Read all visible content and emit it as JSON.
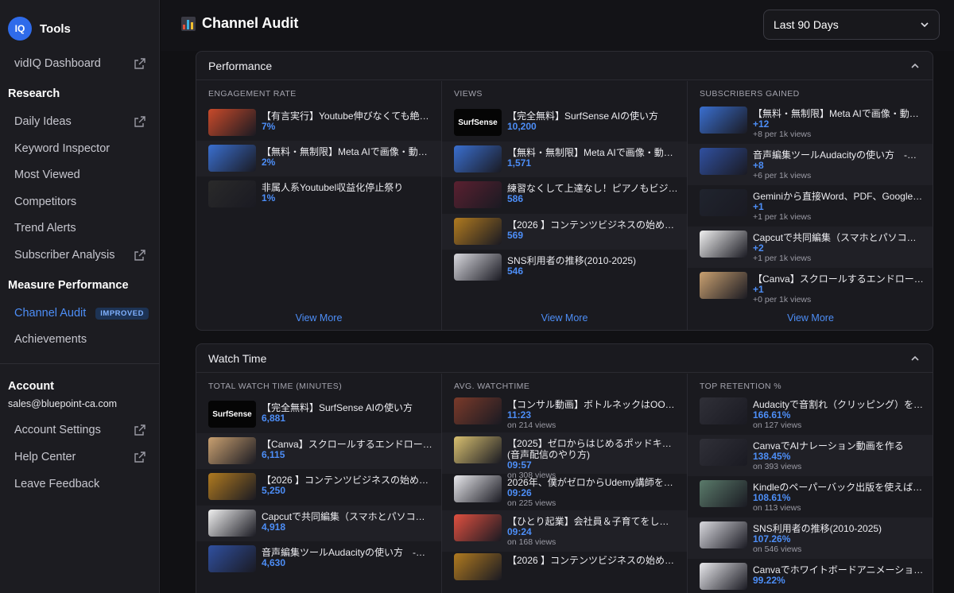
{
  "app": {
    "logo_text": "IQ",
    "name": "Tools"
  },
  "sidebar": {
    "dashboard": "vidIQ Dashboard",
    "research_heading": "Research",
    "research_items": [
      "Daily Ideas",
      "Keyword Inspector",
      "Most Viewed",
      "Competitors",
      "Trend Alerts",
      "Subscriber Analysis"
    ],
    "measure_heading": "Measure Performance",
    "channel_audit": "Channel Audit",
    "channel_audit_badge": "IMPROVED",
    "achievements": "Achievements",
    "account_heading": "Account",
    "email": "sales@bluepoint-ca.com",
    "account_settings": "Account Settings",
    "help_center": "Help Center",
    "leave_feedback": "Leave Feedback"
  },
  "header": {
    "title": "Channel Audit",
    "range": "Last 90 Days"
  },
  "performance": {
    "title": "Performance",
    "engagement": {
      "title": "ENGAGEMENT RATE",
      "items": [
        {
          "title": "【有言実行】Youtube伸びなくても絶対...",
          "value": "7%",
          "thumb": "#c94a2a"
        },
        {
          "title": "【無料・無制限】Meta AIで画像・動画...",
          "value": "2%",
          "thumb": "#3a6fd0"
        },
        {
          "title": "非属人系Youtubel収益化停止祭り",
          "value": "1%",
          "thumb": "#2a2a2a"
        }
      ],
      "view_more": "View More"
    },
    "views": {
      "title": "VIEWS",
      "items": [
        {
          "title": "【完全無料】SurfSense AIの使い方",
          "value": "10,200",
          "thumb": "surfsense",
          "thumb_text": "SurfSense"
        },
        {
          "title": "【無料・無制限】Meta AIで画像・動画...",
          "value": "1,571",
          "thumb": "#3a6fd0"
        },
        {
          "title": "練習なくして上達なし！ピアノもビジネ...",
          "value": "586",
          "thumb": "#5a2030"
        },
        {
          "title": "【2026 】コンテンツビジネスの始め方...",
          "value": "569",
          "thumb": "#b07a20"
        },
        {
          "title": "SNS利用者の推移(2010-2025)",
          "value": "546",
          "thumb": "#d8d8de"
        }
      ],
      "view_more": "View More"
    },
    "subscribers": {
      "title": "SUBSCRIBERS GAINED",
      "items": [
        {
          "title": "【無料・無制限】Meta AIで画像・動画...",
          "value": "+12",
          "sub": "+8 per 1k views",
          "thumb": "#3a6fd0"
        },
        {
          "title": "音声編集ツールAudacityの使い方　-マ...",
          "value": "+8",
          "sub": "+6 per 1k views",
          "thumb": "#3050a0"
        },
        {
          "title": "Geminiから直接Word、PDF、Googleド...",
          "value": "+1",
          "sub": "+1 per 1k views",
          "thumb": "#20242e"
        },
        {
          "title": "Capcutで共同編集（スマホとパソコン同...",
          "value": "+2",
          "sub": "+1 per 1k views",
          "thumb": "#f0f0f0"
        },
        {
          "title": "【Canva】スクロールするエンドロール...",
          "value": "+1",
          "sub": "+0 per 1k views",
          "thumb": "#c9a070"
        }
      ],
      "view_more": "View More"
    }
  },
  "watch": {
    "title": "Watch Time",
    "total": {
      "title": "TOTAL WATCH TIME (MINUTES)",
      "items": [
        {
          "title": "【完全無料】SurfSense AIの使い方",
          "value": "6,881",
          "thumb": "surfsense",
          "thumb_text": "SurfSense"
        },
        {
          "title": "【Canva】スクロールするエンドロール...",
          "value": "6,115",
          "thumb": "#c9a070"
        },
        {
          "title": "【2026 】コンテンツビジネスの始め方...",
          "value": "5,250",
          "thumb": "#b07a20"
        },
        {
          "title": "Capcutで共同編集（スマホとパソコン同...",
          "value": "4,918",
          "thumb": "#f0f0f0"
        },
        {
          "title": "音声編集ツールAudacityの使い方　-マ...",
          "value": "4,630",
          "thumb": "#3050a0"
        }
      ]
    },
    "avg": {
      "title": "AVG. WATCHTIME",
      "items": [
        {
          "title": "【コンサル動画】ボトルネックはOOに...",
          "value": "11:23",
          "sub": "on 214 views",
          "thumb": "#7a3a2a"
        },
        {
          "title": "【2025】ゼロからはじめるポッドキャスト",
          "title2": "(音声配信のやり方)",
          "value": "09:57",
          "sub": "on 308 views",
          "thumb": "#d8c070"
        },
        {
          "title": "2026年、僕がゼロからUdemy講師を始...",
          "value": "09:26",
          "sub": "on 225 views",
          "thumb": "#e8e8ec"
        },
        {
          "title": "【ひとり起業】会社員＆子育てをしなが...",
          "value": "09:24",
          "sub": "on 168 views",
          "thumb": "#e05040"
        },
        {
          "title": "【2026 】コンテンツビジネスの始め方...",
          "value": "",
          "sub": "",
          "thumb": "#b07a20"
        }
      ]
    },
    "retention": {
      "title": "TOP RETENTION %",
      "items": [
        {
          "title": "Audacityで音割れ（クリッピング）を修...",
          "value": "166.61%",
          "sub": "on 127 views",
          "thumb": "#303038"
        },
        {
          "title": "CanvaでAIナレーション動画を作る",
          "value": "138.45%",
          "sub": "on 393 views",
          "thumb": "#303038"
        },
        {
          "title": "Kindleのペーパーバック出版を使えば、...",
          "value": "108.61%",
          "sub": "on 113 views",
          "thumb": "#5a7a6a"
        },
        {
          "title": "SNS利用者の推移(2010-2025)",
          "value": "107.26%",
          "sub": "on 546 views",
          "thumb": "#d8d8de"
        },
        {
          "title": "Canvaでホワイトボードアニメーション...",
          "value": "99.22%",
          "sub": "",
          "thumb": "#e8e8ec"
        }
      ]
    }
  },
  "colors": {
    "accent": "#4d8ef7",
    "bg": "#111114",
    "panel": "#1a1a1f",
    "sidebar": "#1c1c21"
  }
}
